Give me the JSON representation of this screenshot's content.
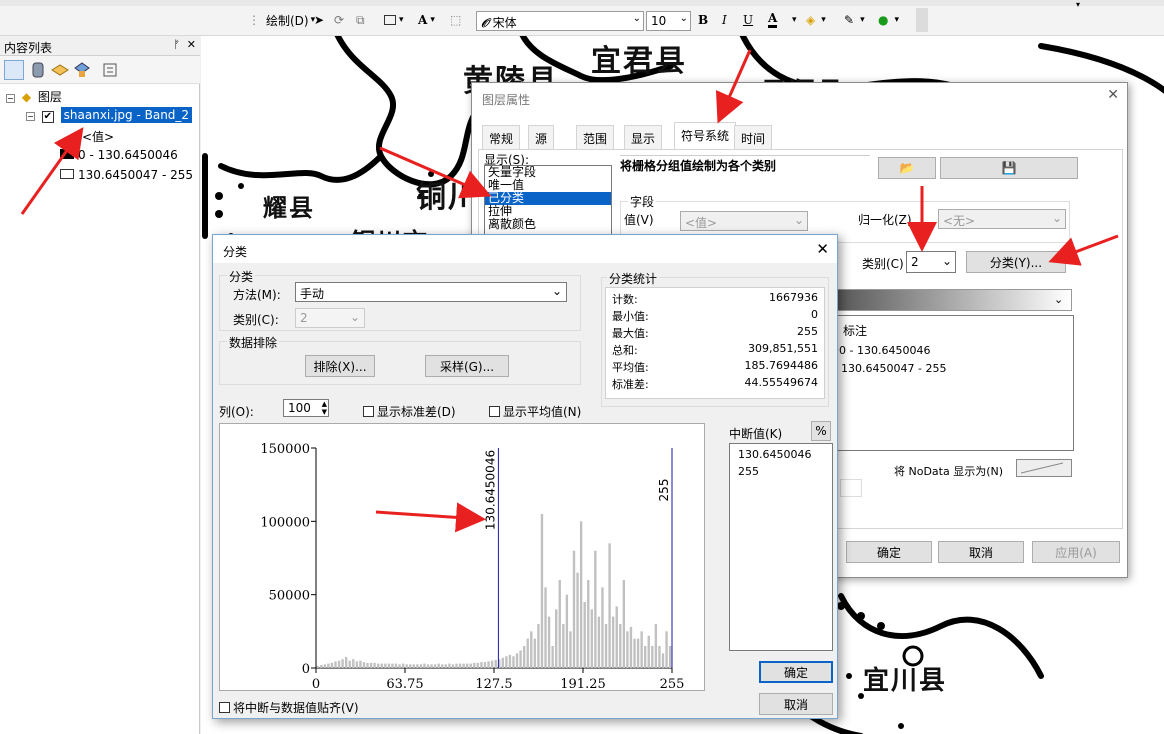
{
  "toolbar": {
    "draw_label": "绘制(D)",
    "font_name": "宋体",
    "font_size": "10",
    "bold": "B",
    "italic": "I",
    "underline": "U",
    "font_color": "A"
  },
  "toc": {
    "title": "内容列表",
    "pin": "↕",
    "close": "✕",
    "root_label": "图层",
    "layer_name": "shaanxi.jpg - Band_2",
    "value_field": "<值>",
    "class1": "0 - 130.6450046",
    "class2": "130.6450047 - 255"
  },
  "map": {
    "labels": [
      "黄陵县",
      "宜君县",
      "铜川",
      "铜川市",
      "耀县",
      "凤翔县",
      "宜川县"
    ]
  },
  "props": {
    "title": "图层属性",
    "tabs": [
      "常规",
      "源",
      "范围",
      "显示",
      "符号系统",
      "时间"
    ],
    "active_tab": "符号系统",
    "show_label": "显示(S):",
    "show_items": [
      "矢量字段",
      "唯一值",
      "已分类",
      "拉伸",
      "离散颜色"
    ],
    "selected_show_item": "已分类",
    "heading": "将栅格分组值绘制为各个类别",
    "field_group": "字段",
    "value_label": "值(V)",
    "value_placeholder": "<值>",
    "normalize_label": "归一化(Z)",
    "normalize_placeholder": "<无>",
    "classes_label": "类别(C)",
    "classes_value": "2",
    "classify_button": "分类(Y)...",
    "label_col": "标注",
    "rows": [
      "0 - 130.6450046",
      "130.6450047 - 255"
    ],
    "nodata_label": "将 NoData 显示为(N)",
    "ok": "确定",
    "cancel": "取消",
    "apply": "应用(A)"
  },
  "classify": {
    "title": "分类",
    "group_label": "分类",
    "method_label": "方法(M):",
    "method_value": "手动",
    "classes_label": "类别(C):",
    "classes_value": "2",
    "exclusion_group": "数据排除",
    "exclude_button": "排除(X)...",
    "sample_button": "采样(G)...",
    "stats_title": "分类统计",
    "stats": [
      {
        "k": "计数:",
        "v": "1667936"
      },
      {
        "k": "最小值:",
        "v": "0"
      },
      {
        "k": "最大值:",
        "v": "255"
      },
      {
        "k": "总和:",
        "v": "309,851,551"
      },
      {
        "k": "平均值:",
        "v": "185.7694486"
      },
      {
        "k": "标准差:",
        "v": "44.55549674"
      }
    ],
    "columns_label": "列(O):",
    "columns_value": "100",
    "show_std": "显示标准差(D)",
    "show_mean": "显示平均值(N)",
    "breaks_label": "中断值(K)",
    "percent_btn": "%",
    "breaks": [
      "130.6450046",
      "255"
    ],
    "snap_label": "将中断与数据值贴齐(V)",
    "ok": "确定",
    "cancel": "取消"
  },
  "chart_data": {
    "type": "bar",
    "xlabel": "",
    "ylabel": "",
    "xlim": [
      0,
      255
    ],
    "ylim": [
      0,
      150000
    ],
    "x_ticks": [
      "0",
      "63.75",
      "127.5",
      "191.25",
      "255"
    ],
    "y_ticks": [
      "0",
      "50000",
      "100000",
      "150000"
    ],
    "break_lines": [
      {
        "value": 130.6450046,
        "label": "130.6450046"
      },
      {
        "value": 255,
        "label": "255"
      }
    ],
    "bin_starts": [
      0,
      2.55,
      5.1,
      7.65,
      10.2,
      12.75,
      15.3,
      17.85,
      20.4,
      22.95,
      25.5,
      28.05,
      30.6,
      33.15,
      35.7,
      38.25,
      40.8,
      43.35,
      45.9,
      48.45,
      51,
      53.55,
      56.1,
      58.65,
      61.2,
      63.75,
      66.3,
      68.85,
      71.4,
      73.95,
      76.5,
      79.05,
      81.6,
      84.15,
      86.7,
      89.25,
      91.8,
      94.35,
      96.9,
      99.45,
      102,
      104.55,
      107.1,
      109.65,
      112.2,
      114.75,
      117.3,
      119.85,
      122.4,
      124.95,
      127.5,
      130.05,
      132.6,
      135.15,
      137.7,
      140.25,
      142.8,
      145.35,
      147.9,
      150.45,
      153,
      155.55,
      158.1,
      160.65,
      163.2,
      165.75,
      168.3,
      170.85,
      173.4,
      175.95,
      178.5,
      181.05,
      183.6,
      186.15,
      188.7,
      191.25,
      193.8,
      196.35,
      198.9,
      201.45,
      204,
      206.55,
      209.1,
      211.65,
      214.2,
      216.75,
      219.3,
      221.85,
      224.4,
      226.95,
      229.5,
      232.05,
      234.6,
      237.15,
      239.7,
      242.25,
      244.8,
      247.35,
      249.9,
      252.45
    ],
    "values": [
      1500,
      2000,
      2500,
      3000,
      3500,
      4500,
      5000,
      6000,
      7500,
      5000,
      6000,
      4500,
      5000,
      4000,
      3500,
      3500,
      3500,
      3000,
      3000,
      3000,
      3000,
      3000,
      3000,
      2500,
      3000,
      2500,
      2500,
      2500,
      2500,
      2500,
      3000,
      2500,
      2500,
      2500,
      3000,
      2500,
      2500,
      3000,
      2500,
      3000,
      3000,
      3000,
      3000,
      3000,
      3500,
      3500,
      4000,
      4000,
      4500,
      5000,
      5500,
      6000,
      7000,
      8000,
      9000,
      8000,
      10000,
      12000,
      15000,
      20000,
      25000,
      20000,
      30000,
      105000,
      55000,
      35000,
      15000,
      40000,
      60000,
      30000,
      50000,
      25000,
      80000,
      65000,
      100000,
      45000,
      60000,
      40000,
      80000,
      35000,
      55000,
      30000,
      85000,
      35000,
      42000,
      30000,
      60000,
      25000,
      28000,
      20000,
      20000,
      25000,
      15000,
      22000,
      15000,
      30000,
      15000,
      10000,
      25000,
      15000
    ]
  }
}
